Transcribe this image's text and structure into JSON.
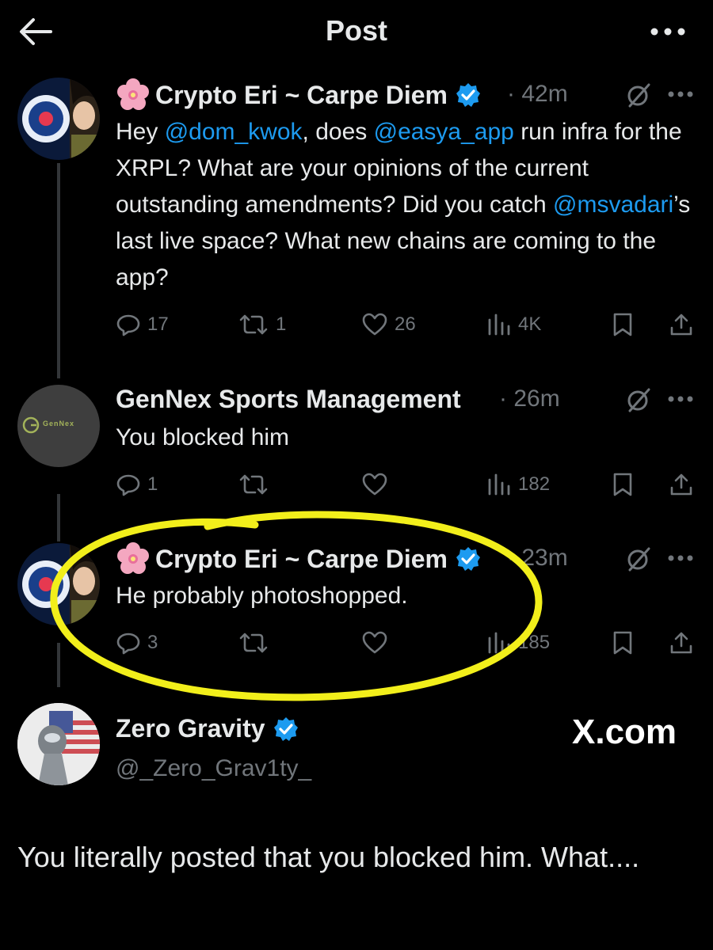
{
  "header": {
    "title": "Post"
  },
  "posts": [
    {
      "author": "Crypto Eri ~ Carpe Diem",
      "time": "· 42m",
      "text_parts": [
        "Hey ",
        "@dom_kwok",
        ", does ",
        "@easya_app",
        " run infra for the XRPL? What are your opinions of the current outstanding amendments? Did you catch ",
        "@msvadari",
        "’s last live space? What new chains are coming to the app?"
      ],
      "replies": "17",
      "reposts": "1",
      "likes": "26",
      "views": "4K"
    },
    {
      "author": "GenNex Sports Management",
      "time": "· 26m",
      "text": "You blocked him",
      "avatar_text": "GenNex",
      "replies": "1",
      "reposts": "",
      "likes": "",
      "views": "182"
    },
    {
      "author": "Crypto Eri ~ Carpe Diem",
      "time": "· 23m",
      "text": "He probably photoshopped.",
      "replies": "3",
      "reposts": "",
      "likes": "",
      "views": "185"
    }
  ],
  "reply": {
    "author": "Zero Gravity",
    "handle": "@_Zero_Grav1ty_",
    "text": "You literally posted that you blocked him. What...."
  },
  "watermark": "X.com",
  "colors": {
    "accent": "#1d9bf0",
    "muted": "#71767b",
    "highlight": "#f2ef1b"
  },
  "icons": [
    "back-arrow-icon",
    "more-icon",
    "verified-icon",
    "grok-icon",
    "reply-icon",
    "repost-icon",
    "like-icon",
    "views-icon",
    "bookmark-icon",
    "share-icon"
  ]
}
